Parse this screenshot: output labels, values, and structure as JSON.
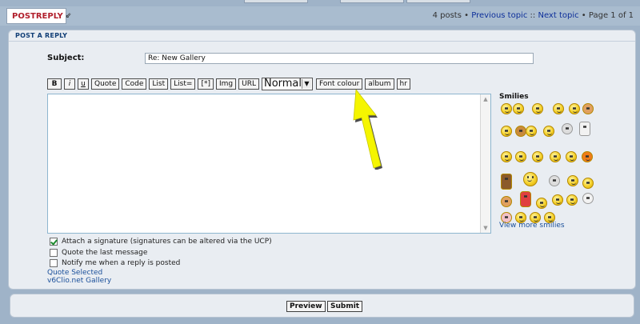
{
  "header": {
    "postreply_label": "POSTREPLY",
    "posts_count": "4 posts",
    "previous_topic": "Previous topic",
    "separator": "::",
    "next_topic": "Next topic",
    "page_info": "Page 1 of 1",
    "bullet": "•"
  },
  "form": {
    "section_title": "POST A REPLY",
    "subject_label": "Subject:",
    "subject_value": "Re: New Gallery",
    "toolbar": {
      "bold": "B",
      "italic": "i",
      "underline": "u",
      "quote": "Quote",
      "code": "Code",
      "list": "List",
      "list_ordered": "List=",
      "list_item": "[*]",
      "img": "Img",
      "url": "URL",
      "font_size": "Normal",
      "font_colour": "Font colour",
      "album": "album",
      "hr": "hr"
    },
    "smilies_title": "Smilies",
    "view_more_smilies": "View more smilies",
    "options": {
      "attach_signature": "Attach a signature (signatures can be altered via the UCP)",
      "quote_last": "Quote the last message",
      "notify_reply": "Notify me when a reply is posted",
      "attach_signature_checked": true,
      "quote_last_checked": false,
      "notify_reply_checked": false
    },
    "quote_selected": "Quote Selected",
    "gallery_link": "v6Clio.net Gallery"
  },
  "actions": {
    "preview": "Preview",
    "submit": "Submit"
  },
  "colors": {
    "background": "#9fb3c8",
    "panel": "#e9edf2",
    "link": "#1a4f9a",
    "arrow": "#f5f500",
    "postreply_red": "#b11f2c"
  }
}
